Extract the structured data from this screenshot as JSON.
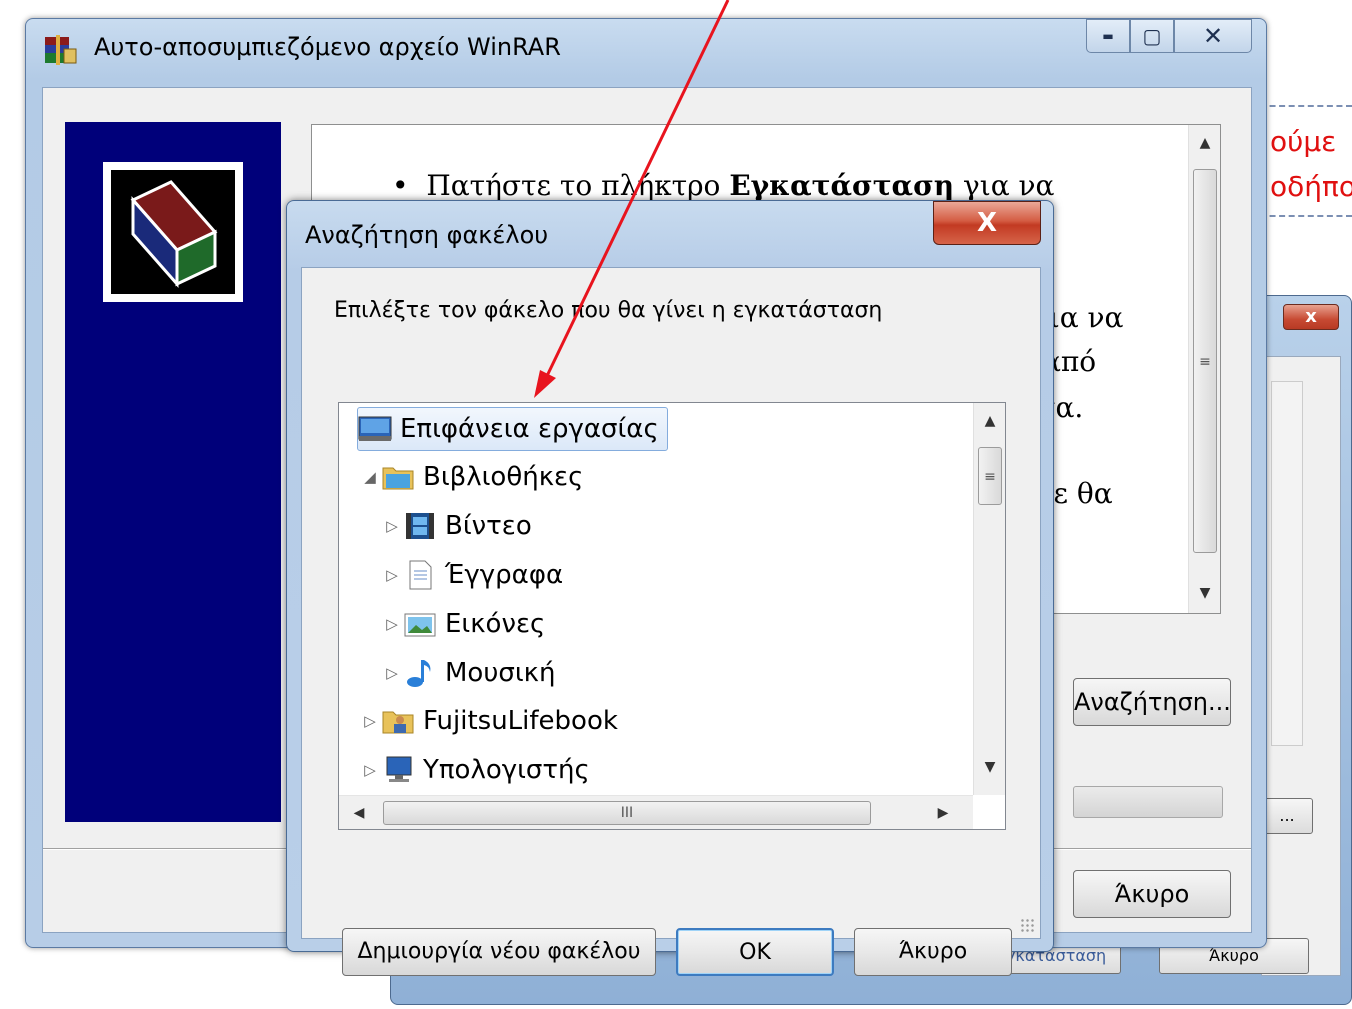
{
  "background_doc": {
    "red_line1": "ούμε",
    "red_line2": "οδήπο"
  },
  "secondary_window": {
    "close_glyph": "x",
    "browse_ellipsis": "...",
    "install_label": "Εγκατάσταση",
    "cancel_label": "Άκυρο"
  },
  "main_window": {
    "title": "Αυτο-αποσυμπιεζόμενο αρχείο WinRAR",
    "minimize_glyph": "▬",
    "maximize_glyph": "▢",
    "close_glyph": "✕",
    "text": {
      "line1_bullet": "•",
      "line1_pre": "Πατήστε το πλήκτρο ",
      "line1_bold": "Εγκατάσταση",
      "line1_post": " για να",
      "line2_tail": "για να",
      "line3_tail": "από",
      "line4_tail": "τα.",
      "line5_tail": "τε θα"
    },
    "browse_button": "Αναζήτηση...",
    "cancel_button": "Άκυρο"
  },
  "dialog": {
    "title": "Αναζήτηση φακέλου",
    "close_glyph": "X",
    "prompt": "Επιλέξτε τον φάκελο που θα γίνει η εγκατάσταση",
    "tree": [
      {
        "label": "Επιφάνεια εργασίας",
        "icon": "desktop-icon",
        "expander": "",
        "selected": true
      },
      {
        "label": "Βιβλιοθήκες",
        "icon": "libraries-icon",
        "expander": "◢",
        "selected": false
      },
      {
        "label": "Βίντεο",
        "icon": "video-icon",
        "expander": "▷",
        "selected": false
      },
      {
        "label": "Έγγραφα",
        "icon": "documents-icon",
        "expander": "▷",
        "selected": false
      },
      {
        "label": "Εικόνες",
        "icon": "pictures-icon",
        "expander": "▷",
        "selected": false
      },
      {
        "label": "Μουσική",
        "icon": "music-icon",
        "expander": "▷",
        "selected": false
      },
      {
        "label": "FujitsuLifebook",
        "icon": "user-folder-icon",
        "expander": "▷",
        "selected": false
      },
      {
        "label": "Υπολογιστής",
        "icon": "computer-icon",
        "expander": "▷",
        "selected": false
      }
    ],
    "scroll_grip": "III",
    "new_folder_button": "Δημιουργία νέου φακέλου",
    "ok_button": "OK",
    "cancel_button": "Άκυρο"
  },
  "colors": {
    "annotation_arrow": "#e8141e",
    "banner": "#00007a",
    "selection_border": "#84acdd"
  }
}
